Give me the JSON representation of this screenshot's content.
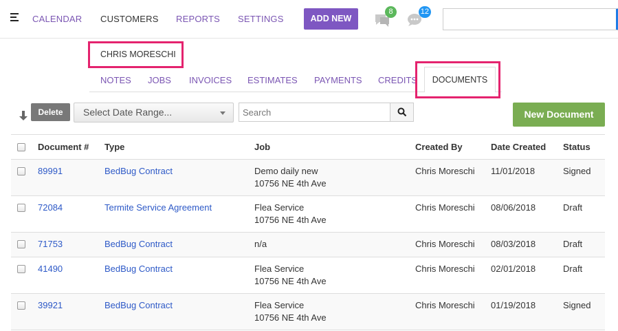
{
  "nav": {
    "items": [
      "CALENDAR",
      "CUSTOMERS",
      "REPORTS",
      "SETTINGS"
    ],
    "active": "CUSTOMERS",
    "add_new_label": "ADD NEW",
    "messages_badge": "8",
    "chat_badge": "12",
    "badge_colors": {
      "messages": "#5cb85c",
      "chat": "#2196f3"
    }
  },
  "customer": {
    "name": "CHRIS MORESCHI"
  },
  "tabs": {
    "items": [
      "NOTES",
      "JOBS",
      "INVOICES",
      "ESTIMATES",
      "PAYMENTS",
      "CREDITS"
    ],
    "active": "DOCUMENTS"
  },
  "toolbar": {
    "delete_label": "Delete",
    "date_range_placeholder": "Select Date Range...",
    "search_placeholder": "Search",
    "new_document_label": "New Document"
  },
  "table": {
    "headers": [
      "Document #",
      "Type",
      "Job",
      "Created By",
      "Date Created",
      "Status"
    ],
    "rows": [
      {
        "doc": "89991",
        "type": "BedBug Contract",
        "job1": "Demo daily new",
        "job2": "10756 NE 4th Ave",
        "created_by": "Chris Moreschi",
        "date": "11/01/2018",
        "status": "Signed"
      },
      {
        "doc": "72084",
        "type": "Termite Service Agreement",
        "job1": "Flea Service",
        "job2": "10756 NE 4th Ave",
        "created_by": "Chris Moreschi",
        "date": "08/06/2018",
        "status": "Draft"
      },
      {
        "doc": "71753",
        "type": "BedBug Contract",
        "job1": "n/a",
        "job2": "",
        "created_by": "Chris Moreschi",
        "date": "08/03/2018",
        "status": "Draft"
      },
      {
        "doc": "41490",
        "type": "BedBug Contract",
        "job1": "Flea Service",
        "job2": "10756 NE 4th Ave",
        "created_by": "Chris Moreschi",
        "date": "02/01/2018",
        "status": "Draft"
      },
      {
        "doc": "39921",
        "type": "BedBug Contract",
        "job1": "Flea Service",
        "job2": "10756 NE 4th Ave",
        "created_by": "Chris Moreschi",
        "date": "01/19/2018",
        "status": "Signed"
      }
    ]
  }
}
